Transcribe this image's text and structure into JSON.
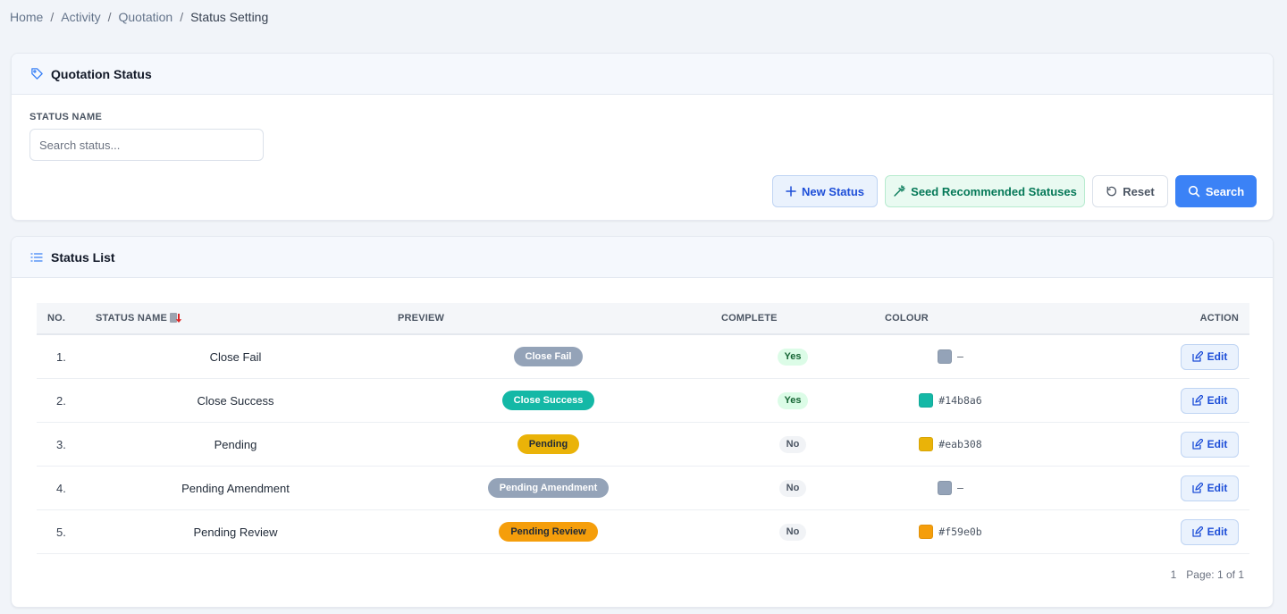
{
  "breadcrumb": {
    "items": [
      "Home",
      "Activity",
      "Quotation",
      "Status Setting"
    ],
    "separator": "/"
  },
  "filter_card": {
    "title": "Quotation Status",
    "icon": "tag-icon",
    "field_label": "STATUS NAME",
    "search_placeholder": "Search status...",
    "search_value": "",
    "buttons": {
      "new_status": "New Status",
      "seed": "Seed Recommended Statuses",
      "reset": "Reset",
      "search": "Search"
    }
  },
  "list_card": {
    "title": "Status List",
    "icon": "list-icon",
    "columns": {
      "no": "NO.",
      "name": "STATUS NAME",
      "preview": "PREVIEW",
      "complete": "COMPLETE",
      "colour": "COLOUR",
      "action": "ACTION"
    },
    "rows": [
      {
        "no": "1.",
        "name": "Close Fail",
        "preview": "Close Fail",
        "pill_bg": "#94a3b8",
        "pill_fg": "#ffffff",
        "complete": "Yes",
        "swatch": "#94a3b8",
        "colour": "—"
      },
      {
        "no": "2.",
        "name": "Close Success",
        "preview": "Close Success",
        "pill_bg": "#14b8a6",
        "pill_fg": "#ffffff",
        "complete": "Yes",
        "swatch": "#14b8a6",
        "colour": "#14b8a6"
      },
      {
        "no": "3.",
        "name": "Pending",
        "preview": "Pending",
        "pill_bg": "#eab308",
        "pill_fg": "#1f2937",
        "complete": "No",
        "swatch": "#eab308",
        "colour": "#eab308"
      },
      {
        "no": "4.",
        "name": "Pending Amendment",
        "preview": "Pending Amendment",
        "pill_bg": "#94a3b8",
        "pill_fg": "#ffffff",
        "complete": "No",
        "swatch": "#94a3b8",
        "colour": "—"
      },
      {
        "no": "5.",
        "name": "Pending Review",
        "preview": "Pending Review",
        "pill_bg": "#f59e0b",
        "pill_fg": "#1f2937",
        "complete": "No",
        "swatch": "#f59e0b",
        "colour": "#f59e0b"
      }
    ],
    "edit_label": "Edit",
    "pager": {
      "current": "1",
      "label": "Page: 1 of 1"
    }
  },
  "colors": {
    "accent": "#3b82f6",
    "page_bg": "#f1f4f9",
    "yes_bg": "#dcfce7",
    "no_bg": "#f1f3f6"
  }
}
